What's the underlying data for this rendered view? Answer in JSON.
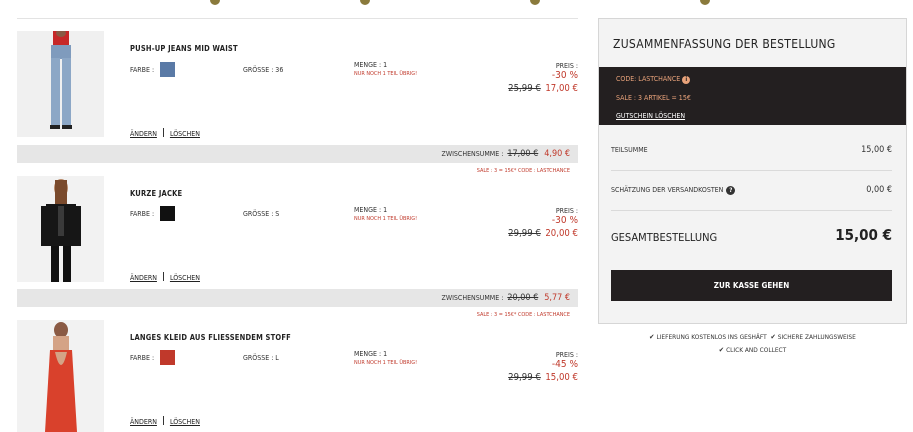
{
  "cart": {
    "items": [
      {
        "name": "PUSH-UP JEANS MID WAIST",
        "color_label": "FARBE :",
        "size_label": "GRÖSSE : 36",
        "qty_label": "MENGE : 1",
        "qty_warning": "NUR NOCH 1 TEIL ÜBRIG!",
        "price_label": "PREIS :",
        "discount": "-30 %",
        "old_price": "25,99 €",
        "new_price": "17,00 €",
        "edit": "ÄNDERN",
        "delete": "LÖSCHEN",
        "swatch_color": "#5a7aa6",
        "image_icon": "jeans-model-photo"
      },
      {
        "name": "KURZE JACKE",
        "color_label": "FARBE :",
        "size_label": "GRÖSSE : S",
        "qty_label": "MENGE : 1",
        "qty_warning": "NUR NOCH 1 TEIL ÜBRIG!",
        "price_label": "PREIS :",
        "discount": "-30 %",
        "old_price": "29,99 €",
        "new_price": "20,00 €",
        "edit": "ÄNDERN",
        "delete": "LÖSCHEN",
        "swatch_color": "#111111",
        "image_icon": "jacket-model-photo"
      },
      {
        "name": "LANGES KLEID AUS FLIESSENDEM STOFF",
        "color_label": "FARBE :",
        "size_label": "GRÖSSE : L",
        "qty_label": "MENGE : 1",
        "qty_warning": "NUR NOCH 1 TEIL ÜBRIG!",
        "price_label": "PREIS :",
        "discount": "-45 %",
        "old_price": "29,99 €",
        "new_price": "15,00 €",
        "edit": "ÄNDERN",
        "delete": "LÖSCHEN",
        "swatch_color": "#c0392b",
        "image_icon": "dress-model-photo"
      }
    ],
    "subtotals": [
      {
        "label": "ZWISCHENSUMME :",
        "old": "17,00 €",
        "new": "4,90 €",
        "promo": "SALE : 3 = 15€* CODE : LASTCHANCE"
      },
      {
        "label": "ZWISCHENSUMME :",
        "old": "20,00 €",
        "new": "5,77 €",
        "promo": "SALE : 3 = 15€* CODE : LASTCHANCE"
      }
    ]
  },
  "summary": {
    "title": "ZUSAMMENFASSUNG DER BESTELLUNG",
    "code_line": "CODE: LASTCHANCE",
    "sale_line": "SALE : 3 ARTIKEL = 15€",
    "remove_coupon": "GUTSCHEIN LÖSCHEN",
    "subtotal_label": "TEILSUMME",
    "subtotal_value": "15,00 €",
    "shipping_label": "SCHÄTZUNG DER VERSANDKOSTEN",
    "shipping_value": "0,00 €",
    "total_label": "GESAMTBESTELLUNG",
    "total_value": "15,00 €",
    "checkout_label": "ZUR KASSE GEHEN"
  },
  "perks": {
    "line1": [
      "LIEFERUNG KOSTENLOS INS GESHÄFT",
      "SICHERE ZAHLUNGSWEISE"
    ],
    "line2": "CLICK AND COLLECT"
  },
  "colors": {
    "accent": "#231f20",
    "sale": "#c0392b",
    "code": "#e8a27a"
  }
}
